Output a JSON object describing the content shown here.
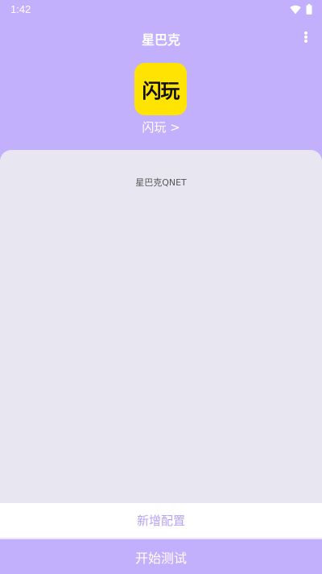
{
  "status_bar": {
    "time": "1:42",
    "icons": [
      "wifi-icon",
      "battery-icon"
    ]
  },
  "toolbar": {
    "title": "星巴克",
    "menu_icon": "more-vert-icon"
  },
  "app": {
    "icon_text": "闪玩",
    "icon_color": "#ffe302",
    "link_label": "闪玩 >"
  },
  "config_list": {
    "items": [
      "星巴克QNET"
    ]
  },
  "actions": {
    "add_config_label": "新增配置",
    "start_test_label": "开始测试"
  },
  "colors": {
    "primary": "#c2b0fd",
    "card_background": "#e8e7f1",
    "add_config_text": "#b6a3f6"
  }
}
